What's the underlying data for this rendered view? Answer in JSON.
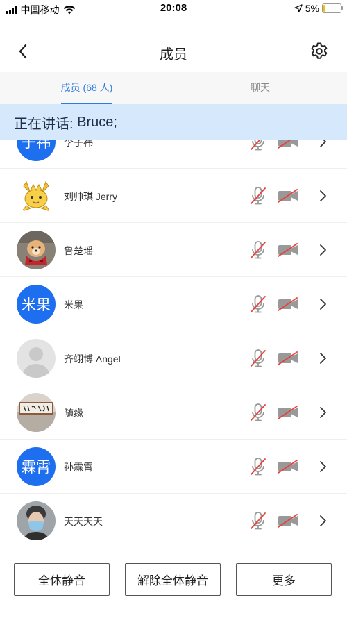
{
  "status_bar": {
    "carrier": "中国移动",
    "time": "20:08",
    "battery_text": "5%",
    "battery_level": 0.05
  },
  "nav": {
    "title": "成员",
    "back_icon": "chevron-left-icon",
    "settings_icon": "gear-icon"
  },
  "tabs": [
    {
      "label": "成员 (68 人)",
      "active": true
    },
    {
      "label": "聊天",
      "active": false
    }
  ],
  "speaking": {
    "label": "正在讲话: ",
    "speakers": "Bruce;"
  },
  "members": [
    {
      "name": "李子祎",
      "avatar_text": "子祎",
      "avatar_type": "text",
      "mic_muted": true,
      "camera_off": true
    },
    {
      "name": "刘帅琪 Jerry",
      "avatar_text": "",
      "avatar_type": "image",
      "avatar_icon": "cartoon-character-icon",
      "mic_muted": true,
      "camera_off": true
    },
    {
      "name": "鲁楚瑶",
      "avatar_text": "",
      "avatar_type": "image",
      "avatar_icon": "dog-photo-icon",
      "mic_muted": true,
      "camera_off": true
    },
    {
      "name": "米果",
      "avatar_text": "米果",
      "avatar_type": "text",
      "mic_muted": true,
      "camera_off": true
    },
    {
      "name": "齐翊博 Angel",
      "avatar_text": "",
      "avatar_type": "image",
      "avatar_icon": "default-person-icon",
      "mic_muted": true,
      "camera_off": true
    },
    {
      "name": "随缘",
      "avatar_text": "",
      "avatar_type": "image",
      "avatar_icon": "calligraphy-plaque-icon",
      "mic_muted": true,
      "camera_off": true
    },
    {
      "name": "孙霖霄",
      "avatar_text": "霖霄",
      "avatar_type": "text",
      "mic_muted": true,
      "camera_off": true
    },
    {
      "name": "天天天天",
      "avatar_text": "",
      "avatar_type": "image",
      "avatar_icon": "masked-person-photo-icon",
      "mic_muted": true,
      "camera_off": true
    }
  ],
  "bottom_buttons": {
    "mute_all": "全体静音",
    "unmute_all": "解除全体静音",
    "more": "更多"
  },
  "colors": {
    "accent": "#2e7ddc",
    "avatar_blue": "#1e6ff0",
    "speaking_bg": "#d6e9fc",
    "muted_red": "#e8413c",
    "icon_gray": "#999999"
  }
}
